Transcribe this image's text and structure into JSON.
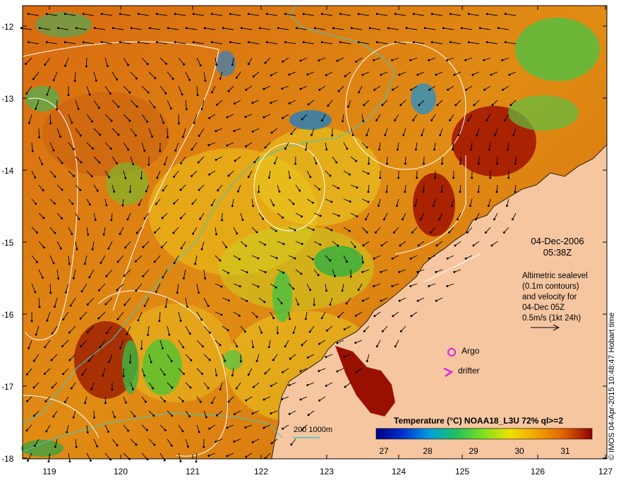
{
  "map": {
    "y_ticks": [
      "-12",
      "-13",
      "-14",
      "-15",
      "-16",
      "-17",
      "-18"
    ],
    "x_ticks": [
      "119",
      "120",
      "121",
      "122",
      "123",
      "124",
      "125",
      "126",
      "127"
    ],
    "date_line1": "04-Dec-2006",
    "date_line2": "05:38Z",
    "note_lines": [
      "Altimetric sealevel",
      "(0.1m contours)",
      "and velocity for",
      "04-Dec 05Z",
      "0.5m/s (1kt 24h)"
    ],
    "legend": {
      "argo": "Argo",
      "drifter": "drifter",
      "scale": "200  1000m"
    },
    "colorbar": {
      "title": "Temperature (°C) NOAA18_L3U 72% ql>=2",
      "ticks": [
        "27",
        "28",
        "29",
        "30",
        "31"
      ]
    },
    "credit": "© IMOS 04-Apr-2015 10:48:47 Hobart time",
    "colors": {
      "land": "#f6c6a0",
      "contour": "#ffffff",
      "isobath": "#3cc8c8",
      "argo": "#e020e0"
    }
  }
}
